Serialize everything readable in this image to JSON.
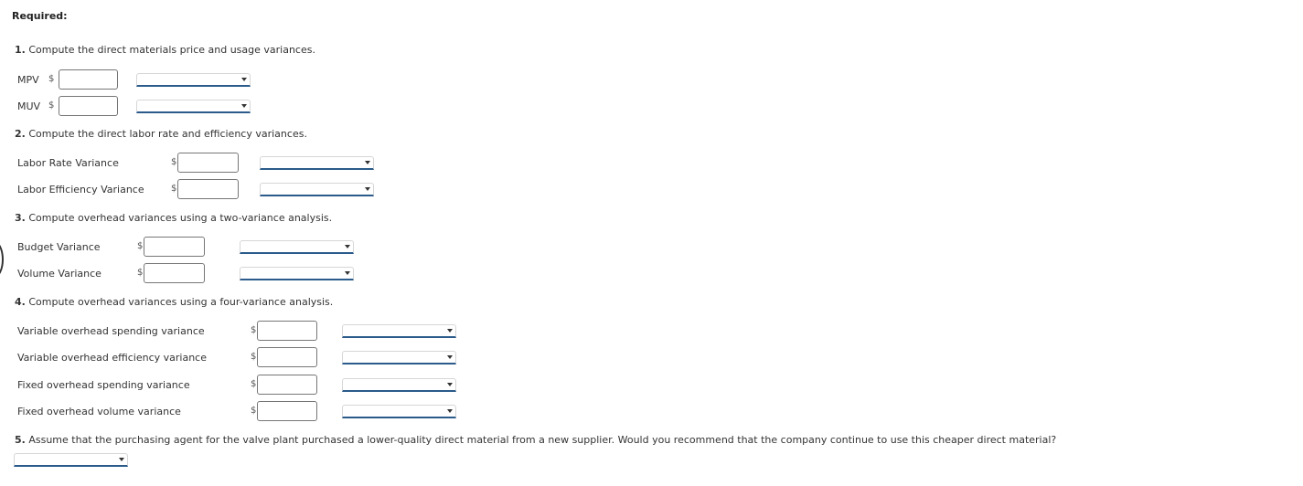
{
  "required_label": "Required:",
  "questions": [
    {
      "num": "1.",
      "text": " Compute the direct materials price and usage variances.",
      "rows": [
        {
          "label": "MPV",
          "currency": "$",
          "value": "",
          "selection": ""
        },
        {
          "label": "MUV",
          "currency": "$",
          "value": "",
          "selection": ""
        }
      ]
    },
    {
      "num": "2.",
      "text": " Compute the direct labor rate and efficiency variances.",
      "rows": [
        {
          "label": "Labor Rate Variance",
          "currency": "$",
          "value": "",
          "selection": ""
        },
        {
          "label": "Labor Efficiency Variance",
          "currency": "$",
          "value": "",
          "selection": ""
        }
      ]
    },
    {
      "num": "3.",
      "text": " Compute overhead variances using a two-variance analysis.",
      "rows": [
        {
          "label": "Budget Variance",
          "currency": "$",
          "value": "",
          "selection": ""
        },
        {
          "label": "Volume Variance",
          "currency": "$",
          "value": "",
          "selection": ""
        }
      ]
    },
    {
      "num": "4.",
      "text": " Compute overhead variances using a four-variance analysis.",
      "rows": [
        {
          "label": "Variable overhead spending variance",
          "currency": "$",
          "value": "",
          "selection": ""
        },
        {
          "label": "Variable overhead efficiency variance",
          "currency": "$",
          "value": "",
          "selection": ""
        },
        {
          "label": "Fixed overhead spending variance",
          "currency": "$",
          "value": "",
          "selection": ""
        },
        {
          "label": "Fixed overhead volume variance",
          "currency": "$",
          "value": "",
          "selection": ""
        }
      ]
    },
    {
      "num": "5.",
      "text": " Assume that the purchasing agent for the valve plant purchased a lower-quality direct material from a new supplier. Would you recommend that the company continue to use this cheaper direct material?",
      "selection": ""
    }
  ],
  "icons": {
    "dropdown_caret": "caret-down-icon"
  }
}
